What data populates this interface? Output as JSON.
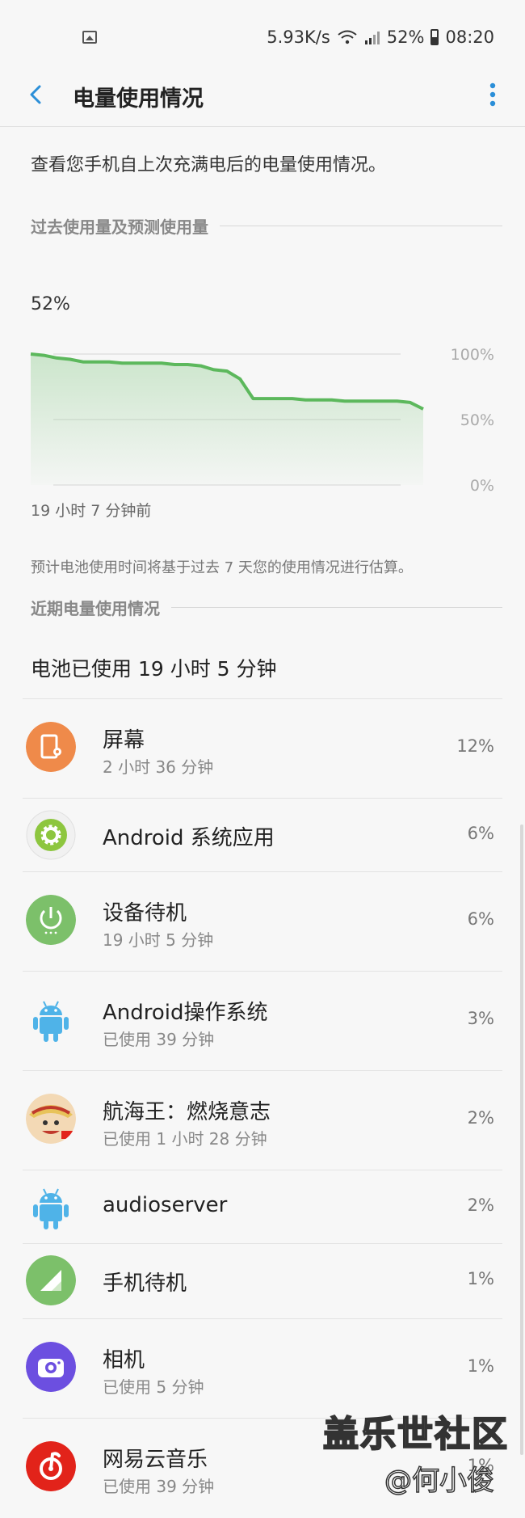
{
  "status_bar": {
    "speed": "5.93K/s",
    "battery": "52%",
    "time": "08:20"
  },
  "app_bar": {
    "title": "电量使用情况"
  },
  "intro": "查看您手机自上次充满电后的电量使用情况。",
  "section_past": "过去使用量及预测使用量",
  "chart_data": {
    "type": "area",
    "current_label": "52%",
    "x_label": "19 小时 7 分钟前",
    "y_ticks": [
      "100%",
      "50%",
      "0%"
    ],
    "ylim": [
      0,
      100
    ],
    "series": [
      {
        "values": [
          100,
          99,
          97,
          96,
          94,
          94,
          94,
          93,
          93,
          93,
          93,
          92,
          92,
          91,
          88,
          87,
          81,
          66,
          66,
          66,
          66,
          65,
          65,
          65,
          64,
          64,
          64,
          64,
          64,
          63,
          58
        ]
      }
    ],
    "grid": true,
    "color": "#5cb85c"
  },
  "note": "预计电池使用时间将基于过去 7 天您的使用情况进行估算。",
  "section_recent": "近期电量使用情况",
  "used_total": "电池已使用 19 小时 5 分钟",
  "apps": [
    {
      "name": "屏幕",
      "sub": "2 小时 36 分钟",
      "pct": "12%",
      "icon": "screen-icon",
      "color": "#ef8a4a"
    },
    {
      "name": "Android 系统应用",
      "sub": "",
      "pct": "6%",
      "icon": "android-system-icon",
      "color": "#8dc63f"
    },
    {
      "name": "设备待机",
      "sub": "19 小时 5 分钟",
      "pct": "6%",
      "icon": "power-icon",
      "color": "#7cc06a"
    },
    {
      "name": "Android操作系统",
      "sub": "已使用 39 分钟",
      "pct": "3%",
      "icon": "android-icon",
      "color": "#4fb3e8"
    },
    {
      "name": "航海王：燃烧意志",
      "sub": "已使用 1 小时 28 分钟",
      "pct": "2%",
      "icon": "game-icon",
      "color": "#c0392b"
    },
    {
      "name": "audioserver",
      "sub": "",
      "pct": "2%",
      "icon": "android-icon",
      "color": "#4fb3e8"
    },
    {
      "name": "手机待机",
      "sub": "",
      "pct": "1%",
      "icon": "signal-icon",
      "color": "#7cc06a"
    },
    {
      "name": "相机",
      "sub": "已使用 5 分钟",
      "pct": "1%",
      "icon": "camera-icon",
      "color": "#6c4fe0"
    },
    {
      "name": "网易云音乐",
      "sub": "已使用 39 分钟",
      "pct": "1%",
      "icon": "netease-music-icon",
      "color": "#e2231a"
    }
  ],
  "watermark": {
    "line1": "盖乐世社区",
    "line2": "@何小俊"
  }
}
